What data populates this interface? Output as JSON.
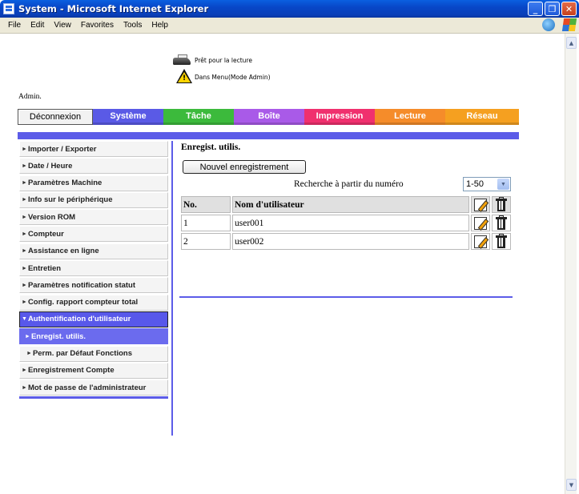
{
  "window": {
    "title": "System - Microsoft Internet Explorer",
    "minimize": "_",
    "maximize": "❐",
    "close": "✕"
  },
  "menubar": {
    "items": [
      {
        "key": "F",
        "rest": "ile"
      },
      {
        "key": "E",
        "rest": "dit"
      },
      {
        "key": "V",
        "rest": "iew"
      },
      {
        "key": "a",
        "pre": "F",
        "rest": "vorites"
      },
      {
        "key": "T",
        "rest": "ools"
      },
      {
        "key": "H",
        "rest": "elp"
      }
    ],
    "labels": [
      "File",
      "Edit",
      "View",
      "Favorites",
      "Tools",
      "Help"
    ]
  },
  "status": {
    "ready": "Prêt pour la lecture",
    "mode": "Dans Menu(Mode Admin)"
  },
  "user": {
    "label": "Admin."
  },
  "tabs": {
    "logout": "Déconnexion",
    "items": [
      {
        "label": "Système",
        "color": "#5a5ae6"
      },
      {
        "label": "Tâche",
        "color": "#3cba3c"
      },
      {
        "label": "Boîte",
        "color": "#a95ae8"
      },
      {
        "label": "Impression",
        "color": "#f0306e"
      },
      {
        "label": "Lecture",
        "color": "#f58c2a"
      },
      {
        "label": "Réseau",
        "color": "#f5a020"
      }
    ]
  },
  "sidebar": {
    "items": [
      {
        "label": "Importer / Exporter"
      },
      {
        "label": "Date / Heure"
      },
      {
        "label": "Paramètres Machine"
      },
      {
        "label": "Info sur le périphérique"
      },
      {
        "label": "Version ROM"
      },
      {
        "label": "Compteur"
      },
      {
        "label": "Assistance en ligne"
      },
      {
        "label": "Entretien"
      },
      {
        "label": "Paramètres notification statut"
      },
      {
        "label": "Config. rapport compteur total"
      },
      {
        "label": "Authentification d'utilisateur"
      },
      {
        "label": "Enregist. utilis."
      },
      {
        "label": "Perm. par Défaut Fonctions"
      },
      {
        "label": "Enregistrement Compte"
      },
      {
        "label": "Mot de passe de l'administrateur"
      }
    ],
    "collapsed_arrow": "►",
    "expanded_arrow": "▼"
  },
  "main": {
    "title": "Enregist. utilis.",
    "new_button": "Nouvel enregistrement",
    "search_label": "Recherche à partir du numéro",
    "range": "1-50",
    "table": {
      "headers": {
        "no": "No.",
        "name": "Nom d'utilisateur"
      },
      "rows": [
        {
          "no": "1",
          "name": "user001"
        },
        {
          "no": "2",
          "name": "user002"
        }
      ]
    }
  }
}
